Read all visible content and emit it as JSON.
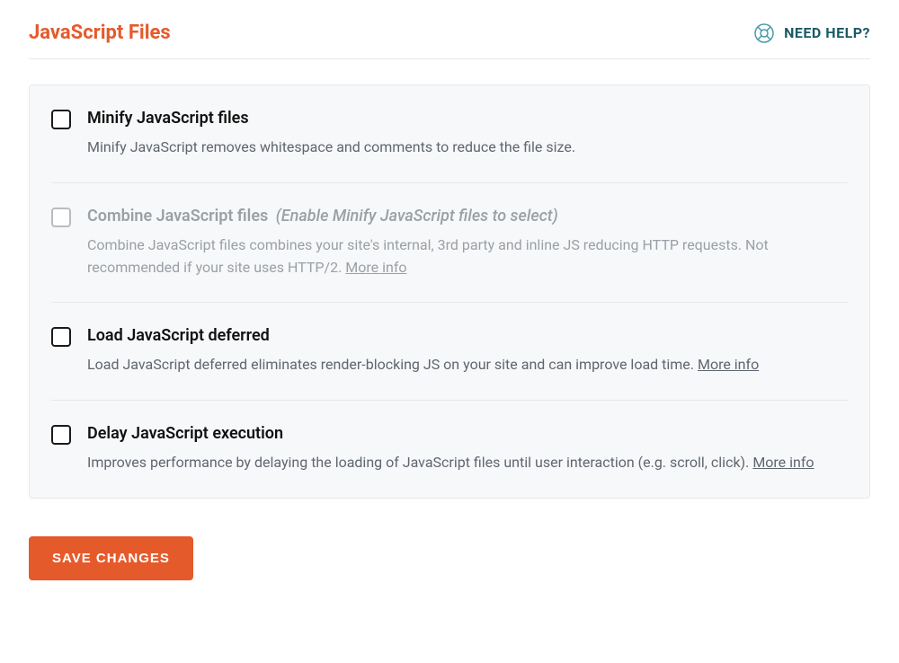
{
  "header": {
    "title": "JavaScript Files",
    "help_label": "NEED HELP?"
  },
  "options": {
    "minify": {
      "title": "Minify JavaScript files",
      "desc": "Minify JavaScript removes whitespace and comments to reduce the file size."
    },
    "combine": {
      "title": "Combine JavaScript files",
      "hint": "(Enable Minify JavaScript files to select)",
      "desc": "Combine JavaScript files combines your site's internal, 3rd party and inline JS reducing HTTP requests. Not recommended if your site uses HTTP/2. ",
      "more": "More info"
    },
    "defer": {
      "title": "Load JavaScript deferred",
      "desc": "Load JavaScript deferred eliminates render-blocking JS on your site and can improve load time. ",
      "more": "More info"
    },
    "delay": {
      "title": "Delay JavaScript execution",
      "desc": "Improves performance by delaying the loading of JavaScript files until user interaction (e.g. scroll, click). ",
      "more": "More info"
    }
  },
  "actions": {
    "save_label": "SAVE CHANGES"
  }
}
